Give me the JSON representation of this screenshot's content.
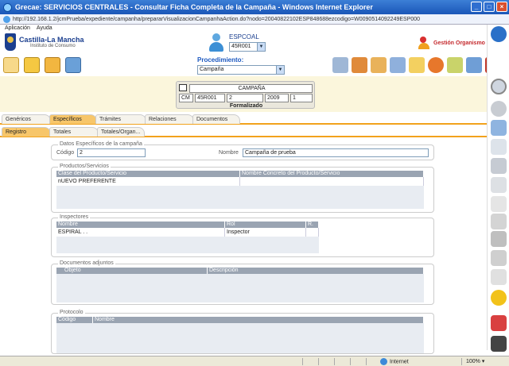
{
  "window": {
    "title": "Grecae: SERVICIOS CENTRALES - Consultar Ficha Completa de la Campaña - Windows Internet Explorer"
  },
  "address": {
    "url": "http://192.168.1.2/jcmPrueba/expediente/campanha/prepararVisualizacionCampanhaAction.do?nodo=20040822102ESP848688ezcodigo=W0090514092249ESP000"
  },
  "menu": {
    "items": [
      "Aplicación",
      "Ayuda"
    ]
  },
  "header": {
    "logo_title": "Castilla-La Mancha",
    "logo_subtitle": "Instituto de Consumo",
    "user_label": "ESPCOAL",
    "user_select": "45R001",
    "gestion": "Gestión Organismo",
    "procedimiento_label": "Procedimiento:",
    "procedimiento_value": "Campaña"
  },
  "campaign": {
    "heading": "CAMPAÑA",
    "code_prefix": "CM",
    "org": "45R001",
    "num": "2",
    "year": "2009",
    "seq": "1",
    "status": "Formalizado"
  },
  "tabs_main": [
    "Genéricos",
    "Específicos",
    "Trámites",
    "Relaciones",
    "Documentos"
  ],
  "tabs_main_active": "Específicos",
  "tabs_sub": [
    "Registro",
    "Totales",
    "Totales/Organ..."
  ],
  "tabs_sub_active": "Registro",
  "datos": {
    "title": "Datos Específicos de la campaña",
    "codigo_label": "Código",
    "codigo_value": "2",
    "nombre_label": "Nombre",
    "nombre_value": "Campaña de prueba"
  },
  "productos": {
    "title": "Productos/Servicios",
    "headers": [
      "Clase del Producto/Servicio",
      "Nombre Concreto del Producto/Servicio"
    ],
    "rows": [
      [
        "nUEVO PREFERENTE",
        ""
      ]
    ]
  },
  "inspectores": {
    "title": "Inspectores",
    "headers": [
      "Nombre",
      "Rol",
      "R."
    ],
    "rows": [
      [
        "ESPIRAL . .",
        "Inspector",
        ""
      ]
    ]
  },
  "documentos": {
    "title": "Documentos adjuntos",
    "headers": [
      "Objeto",
      "Descripción"
    ]
  },
  "protocolo": {
    "title": "Protocolo",
    "headers": [
      "Código",
      "Nombre"
    ]
  },
  "status": {
    "zone": "Internet",
    "zoom": "100%"
  },
  "colors": {
    "accent": "#f2a21c",
    "brand": "#1b3f8f",
    "title_bar": "#1a56b8"
  }
}
